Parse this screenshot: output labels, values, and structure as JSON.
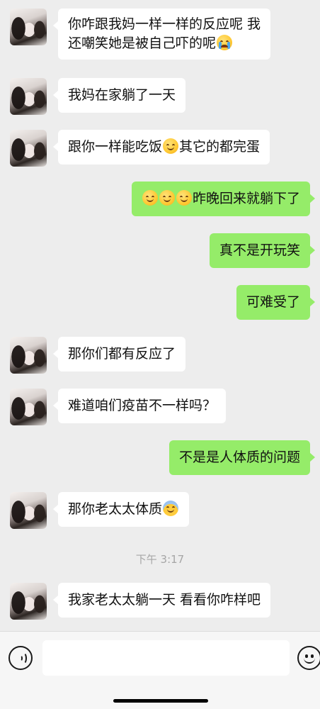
{
  "messages": [
    {
      "side": "in",
      "text_parts": [
        "你咋跟我妈一样一样的反应呢 我",
        "还嘲笑她是被自己吓的呢"
      ],
      "trailing_emoji": "loudly-crying-emoji"
    },
    {
      "side": "in",
      "text": "我妈在家躺了一天"
    },
    {
      "side": "in",
      "text_before": "跟你一样能吃饭",
      "emoji": "hand-over-mouth-emoji",
      "text_after": "其它的都完蛋"
    },
    {
      "side": "out",
      "leading_emojis": [
        "grin-emoji",
        "grin-emoji",
        "grin-emoji"
      ],
      "text": "昨晚回来就躺下了"
    },
    {
      "side": "out",
      "text": "真不是开玩笑"
    },
    {
      "side": "out",
      "text": "可难受了"
    },
    {
      "side": "in",
      "text": "那你们都有反应了"
    },
    {
      "side": "in",
      "text": "难道咱们疫苗不一样吗？"
    },
    {
      "side": "out",
      "text": "不是是人体质的问题"
    },
    {
      "side": "in",
      "text": "那你老太太体质",
      "trailing_emoji": "anxious-sweat-emoji"
    },
    {
      "side": "in",
      "text": "我家老太太躺一天 看看你咋样吧"
    }
  ],
  "timestamp": "下午 3:17",
  "input_bar": {
    "placeholder": ""
  }
}
